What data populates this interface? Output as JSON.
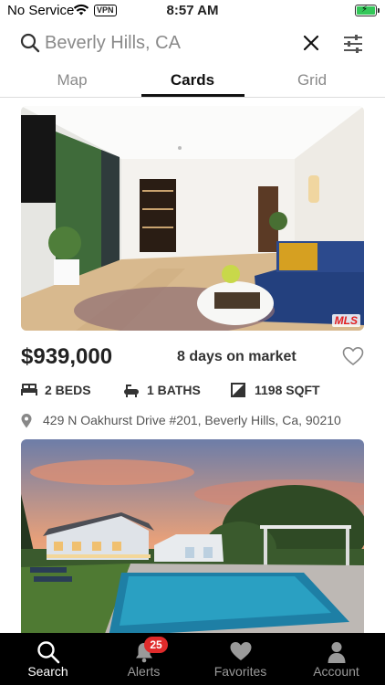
{
  "status_bar": {
    "carrier": "No Service",
    "vpn": "VPN",
    "time": "8:57 AM",
    "battery_color": "#34c759"
  },
  "search": {
    "query": "Beverly Hills, CA",
    "search_icon": "magnifier-icon",
    "clear_icon": "close-icon",
    "filter_icon": "sliders-icon"
  },
  "tabs": [
    {
      "label": "Map",
      "active": false
    },
    {
      "label": "Cards",
      "active": true
    },
    {
      "label": "Grid",
      "active": false
    }
  ],
  "listings": [
    {
      "price": "$939,000",
      "days_on_market": "8 days on market",
      "beds": "2 BEDS",
      "baths": "1 BATHS",
      "sqft": "1198 SQFT",
      "address": "429 N Oakhurst Drive #201, Beverly Hills, Ca, 90210",
      "photo_logo": "MLS"
    },
    {
      "photo_logo": ""
    }
  ],
  "bottom_nav": [
    {
      "label": "Search",
      "icon": "search-icon",
      "active": true
    },
    {
      "label": "Alerts",
      "icon": "bell-icon",
      "active": false,
      "badge": "25"
    },
    {
      "label": "Favorites",
      "icon": "heart-icon",
      "active": false
    },
    {
      "label": "Account",
      "icon": "person-icon",
      "active": false
    }
  ],
  "colors": {
    "accent": "#111111",
    "nav_background": "#000000",
    "badge": "#e02b2b",
    "mls_logo": "#e32020"
  }
}
